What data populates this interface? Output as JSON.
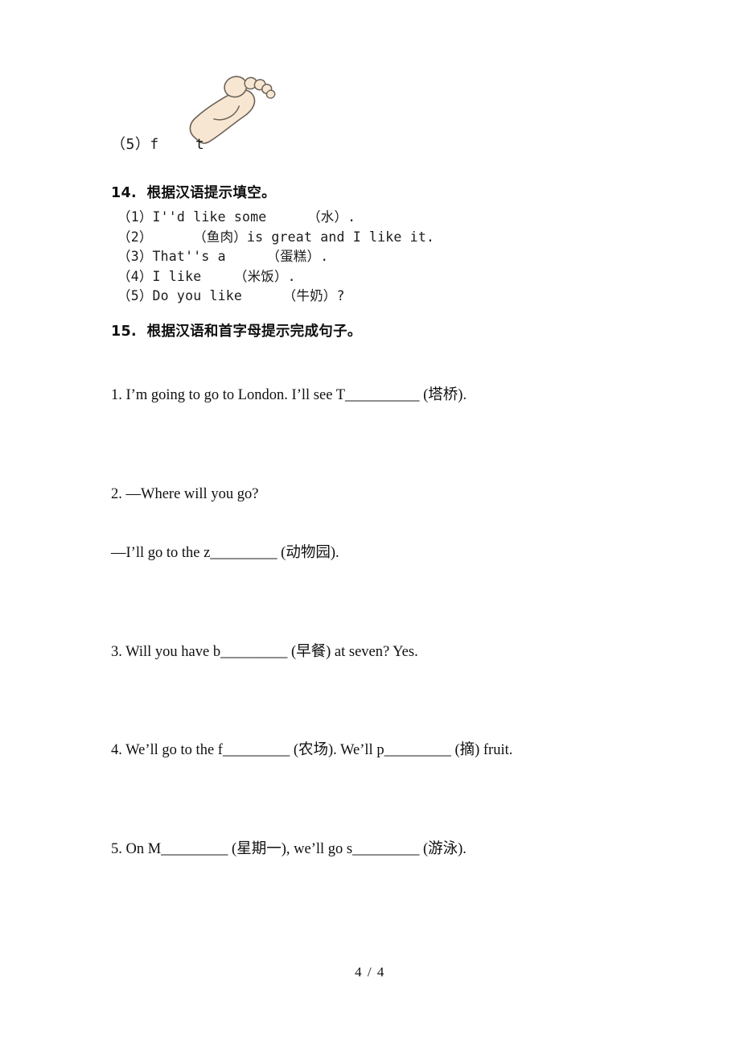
{
  "document": {
    "page_label": "4 / 4",
    "background_color": "#ffffff",
    "text_color": "#1a1a1a"
  },
  "carryover_item": {
    "label": "（5）f    t",
    "image": {
      "name": "foot-illustration",
      "fill_color": "#f7e7d2",
      "outline_color": "#6b6258",
      "description": "foot"
    }
  },
  "sections": [
    {
      "number": "14.",
      "heading": "14.  根据汉语提示填空。",
      "items": [
        "（1）I''d like some     （水）.",
        "（2）     （鱼肉）is great and I like it.",
        "（3）That''s a     （蛋糕）.",
        "（4）I like    （米饭）.",
        "（5）Do you like     （牛奶）?"
      ]
    },
    {
      "number": "15.",
      "heading": "15.  根据汉语和首字母提示完成句子。",
      "items": [
        {
          "line1": "1. I’m going to go to London. I’ll see T__________ (塔桥).",
          "line2": ""
        },
        {
          "line1": "2. —Where will you go?",
          "line2": "—I’ll go to the z_________ (动物园)."
        },
        {
          "line1": "3. Will you have b_________ (早餐) at seven? Yes.",
          "line2": ""
        },
        {
          "line1": "4. We’ll go to the f_________ (农场). We’ll p_________ (摘) fruit.",
          "line2": ""
        },
        {
          "line1": "5. On M_________ (星期一), we’ll go s_________ (游泳).",
          "line2": ""
        }
      ]
    }
  ]
}
